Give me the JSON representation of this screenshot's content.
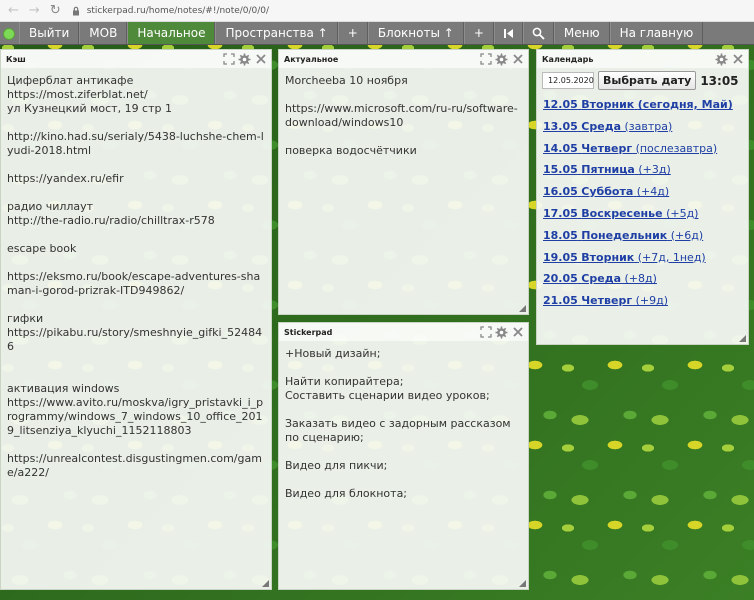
{
  "browser": {
    "url": "stickerpad.ru/home/notes/#!/note/0/0/0/"
  },
  "menu": {
    "items": [
      "Выйти",
      "MOB",
      "Начальное",
      "Пространства ↑",
      "+",
      "Блокноты ↑",
      "+",
      "",
      "",
      "Меню",
      "На главную"
    ],
    "active": "Начальное"
  },
  "panels": {
    "cache": {
      "title": "Кэш",
      "body": "Циферблат антикафе\nhttps://most.ziferblat.net/\nул Кузнецкий мост, 19 стр 1\n\nhttp://kino.had.su/serialy/5438-luchshe-chem-lyudi-2018.html\n\nhttps://yandex.ru/efir\n\nрадио чиллаут\nhttp://the-radio.ru/radio/chilltrax-r578\n\nescape book\n\nhttps://eksmo.ru/book/escape-adventures-shaman-i-gorod-prizrak-ITD949862/\n\nгифки\nhttps://pikabu.ru/story/smeshnyie_gifki_524846\n\n\nактивация windows\nhttps://www.avito.ru/moskva/igry_pristavki_i_programmy/windows_7_windows_10_office_2019_litsenziya_klyuchi_1152118803\n\nhttps://unrealcontest.disgustingmen.com/game/a222/"
    },
    "actual": {
      "title": "Актуальное",
      "body": "Morcheeba 10 ноября\n\nhttps://www.microsoft.com/ru-ru/software-download/windows10\n\nповерка водосчётчики"
    },
    "stickerpad": {
      "title": "Stickerpad",
      "body": "+Новый дизайн;\n\nНайти копирайтера;\nСоставить сценарии видео уроков;\n\nЗаказать видео с задорным рассказом по сценарию;\n\nВидео для пикчи;\n\nВидео для блокнота;"
    },
    "calendar": {
      "title": "Календарь",
      "date_value": "12.05.2020",
      "pick_button": "Выбрать дату",
      "time": "13:05",
      "days": [
        {
          "date": "12.05",
          "weekday": "Вторник",
          "rel": "(сегодня, Май)"
        },
        {
          "date": "13.05",
          "weekday": "Среда",
          "rel": "(завтра)"
        },
        {
          "date": "14.05",
          "weekday": "Четверг",
          "rel": "(послезавтра)"
        },
        {
          "date": "15.05",
          "weekday": "Пятница",
          "rel": "(+3д)"
        },
        {
          "date": "16.05",
          "weekday": "Суббота",
          "rel": "(+4д)"
        },
        {
          "date": "17.05",
          "weekday": "Воскресенье",
          "rel": "(+5д)"
        },
        {
          "date": "18.05",
          "weekday": "Понедельник",
          "rel": "(+6д)"
        },
        {
          "date": "19.05",
          "weekday": "Вторник",
          "rel": "(+7д, 1нед)"
        },
        {
          "date": "20.05",
          "weekday": "Среда",
          "rel": "(+8д)"
        },
        {
          "date": "21.05",
          "weekday": "Четверг",
          "rel": "(+9д)"
        }
      ]
    }
  },
  "icons": {
    "panel_controls": [
      "expand-icon",
      "gear-icon",
      "close-icon"
    ],
    "menu_misc": [
      "play-end-icon",
      "search-icon"
    ]
  }
}
